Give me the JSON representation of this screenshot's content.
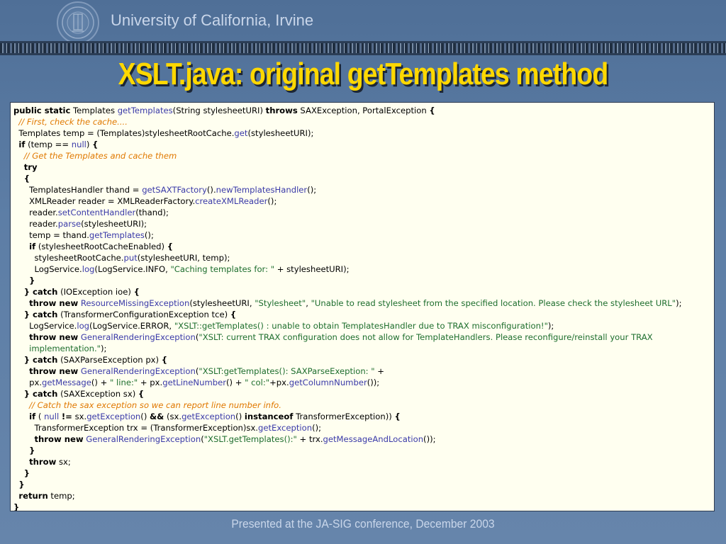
{
  "header": {
    "university": "University of California, Irvine",
    "seal_icon": "university-seal-icon"
  },
  "slide": {
    "title": "XSLT.java: original getTemplates method"
  },
  "footer": {
    "text": "Presented at the JA-SIG conference, December 2003"
  },
  "colors": {
    "title": "#ffd800",
    "keyword": "#000000",
    "method": "#3a3aa8",
    "string": "#1e6e2e",
    "comment": "#e07800",
    "code_background": "#fffff0"
  },
  "code": {
    "lines": [
      [
        {
          "t": "kw",
          "v": "public static"
        },
        {
          "t": "",
          "v": " Templates "
        },
        {
          "t": "fn",
          "v": "getTemplates"
        },
        {
          "t": "",
          "v": "(String stylesheetURI) "
        },
        {
          "t": "kw",
          "v": "throws"
        },
        {
          "t": "",
          "v": " SAXException, PortalException "
        },
        {
          "t": "kw",
          "v": "{"
        }
      ],
      [
        {
          "t": "",
          "v": "  "
        },
        {
          "t": "cm",
          "v": "// First, check the cache...."
        }
      ],
      [
        {
          "t": "",
          "v": "  Templates temp = (Templates)stylesheetRootCache."
        },
        {
          "t": "fn",
          "v": "get"
        },
        {
          "t": "",
          "v": "(stylesheetURI);"
        }
      ],
      [
        {
          "t": "",
          "v": "  "
        },
        {
          "t": "kw",
          "v": "if"
        },
        {
          "t": "",
          "v": " (temp == "
        },
        {
          "t": "fn",
          "v": "null"
        },
        {
          "t": "",
          "v": ") "
        },
        {
          "t": "kw",
          "v": "{"
        }
      ],
      [
        {
          "t": "",
          "v": "    "
        },
        {
          "t": "cm",
          "v": "// Get the Templates and cache them"
        }
      ],
      [
        {
          "t": "",
          "v": "    "
        },
        {
          "t": "kw",
          "v": "try"
        }
      ],
      [
        {
          "t": "",
          "v": "    "
        },
        {
          "t": "kw",
          "v": "{"
        }
      ],
      [
        {
          "t": "",
          "v": "      TemplatesHandler thand = "
        },
        {
          "t": "fn",
          "v": "getSAXTFactory"
        },
        {
          "t": "",
          "v": "()."
        },
        {
          "t": "fn",
          "v": "newTemplatesHandler"
        },
        {
          "t": "",
          "v": "();"
        }
      ],
      [
        {
          "t": "",
          "v": "      XMLReader reader = XMLReaderFactory."
        },
        {
          "t": "fn",
          "v": "createXMLReader"
        },
        {
          "t": "",
          "v": "();"
        }
      ],
      [
        {
          "t": "",
          "v": "      reader."
        },
        {
          "t": "fn",
          "v": "setContentHandler"
        },
        {
          "t": "",
          "v": "(thand);"
        }
      ],
      [
        {
          "t": "",
          "v": "      reader."
        },
        {
          "t": "fn",
          "v": "parse"
        },
        {
          "t": "",
          "v": "(stylesheetURI);"
        }
      ],
      [
        {
          "t": "",
          "v": "      temp = thand."
        },
        {
          "t": "fn",
          "v": "getTemplates"
        },
        {
          "t": "",
          "v": "();"
        }
      ],
      [
        {
          "t": "",
          "v": "      "
        },
        {
          "t": "kw",
          "v": "if"
        },
        {
          "t": "",
          "v": " (stylesheetRootCacheEnabled) "
        },
        {
          "t": "kw",
          "v": "{"
        }
      ],
      [
        {
          "t": "",
          "v": "        stylesheetRootCache."
        },
        {
          "t": "fn",
          "v": "put"
        },
        {
          "t": "",
          "v": "(stylesheetURI, temp);"
        }
      ],
      [
        {
          "t": "",
          "v": "        LogService."
        },
        {
          "t": "fn",
          "v": "log"
        },
        {
          "t": "",
          "v": "(LogService.INFO, "
        },
        {
          "t": "str",
          "v": "\"Caching templates for: \""
        },
        {
          "t": "",
          "v": " + stylesheetURI);"
        }
      ],
      [
        {
          "t": "",
          "v": "      "
        },
        {
          "t": "kw",
          "v": "}"
        }
      ],
      [
        {
          "t": "",
          "v": "    "
        },
        {
          "t": "kw",
          "v": "} catch"
        },
        {
          "t": "",
          "v": " (IOException ioe) "
        },
        {
          "t": "kw",
          "v": "{"
        }
      ],
      [
        {
          "t": "",
          "v": "      "
        },
        {
          "t": "kw",
          "v": "throw new"
        },
        {
          "t": "",
          "v": " "
        },
        {
          "t": "fn",
          "v": "ResourceMissingException"
        },
        {
          "t": "",
          "v": "(stylesheetURI, "
        },
        {
          "t": "str",
          "v": "\"Stylesheet\""
        },
        {
          "t": "",
          "v": ", "
        },
        {
          "t": "str",
          "v": "\"Unable to read stylesheet from the specified location. Please check the stylesheet URL\""
        },
        {
          "t": "",
          "v": ");"
        }
      ],
      [
        {
          "t": "",
          "v": "    "
        },
        {
          "t": "kw",
          "v": "} catch"
        },
        {
          "t": "",
          "v": " (TransformerConfigurationException tce) "
        },
        {
          "t": "kw",
          "v": "{"
        }
      ],
      [
        {
          "t": "",
          "v": "      LogService."
        },
        {
          "t": "fn",
          "v": "log"
        },
        {
          "t": "",
          "v": "(LogService.ERROR, "
        },
        {
          "t": "str",
          "v": "\"XSLT::getTemplates() : unable to obtain TemplatesHandler due to TRAX misconfiguration!\""
        },
        {
          "t": "",
          "v": ");"
        }
      ],
      [
        {
          "t": "",
          "v": "      "
        },
        {
          "t": "kw",
          "v": "throw new"
        },
        {
          "t": "",
          "v": " "
        },
        {
          "t": "fn",
          "v": "GeneralRenderingException"
        },
        {
          "t": "",
          "v": "("
        },
        {
          "t": "str",
          "v": "\"XSLT: current TRAX configuration does not allow for TemplateHandlers. Please reconfigure/reinstall your TRAX"
        }
      ],
      [
        {
          "t": "",
          "v": "      "
        },
        {
          "t": "str",
          "v": "implementation.\""
        },
        {
          "t": "",
          "v": ");"
        }
      ],
      [
        {
          "t": "",
          "v": "    "
        },
        {
          "t": "kw",
          "v": "} catch"
        },
        {
          "t": "",
          "v": " (SAXParseException px) "
        },
        {
          "t": "kw",
          "v": "{"
        }
      ],
      [
        {
          "t": "",
          "v": "      "
        },
        {
          "t": "kw",
          "v": "throw new"
        },
        {
          "t": "",
          "v": " "
        },
        {
          "t": "fn",
          "v": "GeneralRenderingException"
        },
        {
          "t": "",
          "v": "("
        },
        {
          "t": "str",
          "v": "\"XSLT:getTemplates(): SAXParseExeption: \""
        },
        {
          "t": "",
          "v": " +"
        }
      ],
      [
        {
          "t": "",
          "v": "      px."
        },
        {
          "t": "fn",
          "v": "getMessage"
        },
        {
          "t": "",
          "v": "() + "
        },
        {
          "t": "str",
          "v": "\" line:\""
        },
        {
          "t": "",
          "v": " + px."
        },
        {
          "t": "fn",
          "v": "getLineNumber"
        },
        {
          "t": "",
          "v": "() + "
        },
        {
          "t": "str",
          "v": "\" col:\""
        },
        {
          "t": "",
          "v": "+px."
        },
        {
          "t": "fn",
          "v": "getColumnNumber"
        },
        {
          "t": "",
          "v": "());"
        }
      ],
      [
        {
          "t": "",
          "v": "    "
        },
        {
          "t": "kw",
          "v": "} catch"
        },
        {
          "t": "",
          "v": " (SAXException sx) "
        },
        {
          "t": "kw",
          "v": "{"
        }
      ],
      [
        {
          "t": "",
          "v": "      "
        },
        {
          "t": "cm",
          "v": "// Catch the sax exception so we can report line number info."
        }
      ],
      [
        {
          "t": "",
          "v": "      "
        },
        {
          "t": "kw",
          "v": "if"
        },
        {
          "t": "",
          "v": " ( "
        },
        {
          "t": "fn",
          "v": "null"
        },
        {
          "t": "",
          "v": " "
        },
        {
          "t": "kw",
          "v": "!="
        },
        {
          "t": "",
          "v": " sx."
        },
        {
          "t": "fn",
          "v": "getException"
        },
        {
          "t": "",
          "v": "() "
        },
        {
          "t": "kw",
          "v": "&&"
        },
        {
          "t": "",
          "v": " (sx."
        },
        {
          "t": "fn",
          "v": "getException"
        },
        {
          "t": "",
          "v": "() "
        },
        {
          "t": "kw",
          "v": "instanceof"
        },
        {
          "t": "",
          "v": " TransformerException)) "
        },
        {
          "t": "kw",
          "v": "{"
        }
      ],
      [
        {
          "t": "",
          "v": "        TransformerException trx = (TransformerException)sx."
        },
        {
          "t": "fn",
          "v": "getException"
        },
        {
          "t": "",
          "v": "();"
        }
      ],
      [
        {
          "t": "",
          "v": "        "
        },
        {
          "t": "kw",
          "v": "throw new"
        },
        {
          "t": "",
          "v": " "
        },
        {
          "t": "fn",
          "v": "GeneralRenderingException"
        },
        {
          "t": "",
          "v": "("
        },
        {
          "t": "str",
          "v": "\"XSLT.getTemplates():\""
        },
        {
          "t": "",
          "v": " + trx."
        },
        {
          "t": "fn",
          "v": "getMessageAndLocation"
        },
        {
          "t": "",
          "v": "());"
        }
      ],
      [
        {
          "t": "",
          "v": "      "
        },
        {
          "t": "kw",
          "v": "}"
        }
      ],
      [
        {
          "t": "",
          "v": "      "
        },
        {
          "t": "kw",
          "v": "throw"
        },
        {
          "t": "",
          "v": " sx;"
        }
      ],
      [
        {
          "t": "",
          "v": "    "
        },
        {
          "t": "kw",
          "v": "}"
        }
      ],
      [
        {
          "t": "",
          "v": "  "
        },
        {
          "t": "kw",
          "v": "}"
        }
      ],
      [
        {
          "t": "",
          "v": "  "
        },
        {
          "t": "kw",
          "v": "return"
        },
        {
          "t": "",
          "v": " temp;"
        }
      ],
      [
        {
          "t": "kw",
          "v": "}"
        }
      ]
    ]
  }
}
